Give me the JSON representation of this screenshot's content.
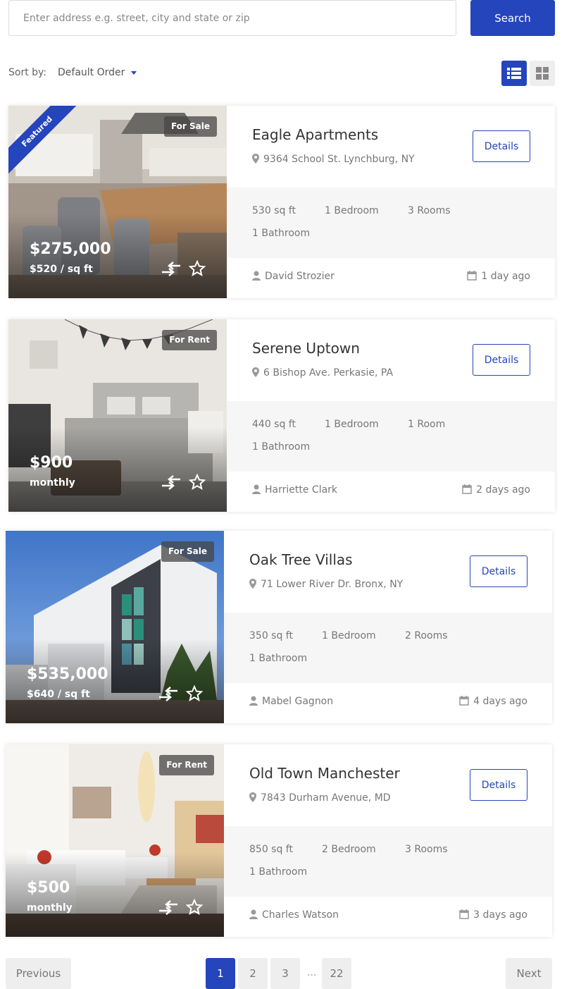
{
  "search": {
    "placeholder": "Enter address e.g. street, city and state or zip",
    "button_label": "Search"
  },
  "sort": {
    "label": "Sort by:",
    "value": "Default Order"
  },
  "view_modes": [
    "list-icon",
    "grid-icon"
  ],
  "accent_color": "#2545bd",
  "listings": [
    {
      "title": "Eagle Apartments",
      "address": "9364 School St. Lynchburg, NY",
      "status": "For Sale",
      "ribbon": "Featured",
      "price": "$275,000",
      "price_sub": "$520 / sq ft",
      "details_label": "Details",
      "features": [
        "530 sq ft",
        "1 Bedroom",
        "3 Rooms",
        "1 Bathroom"
      ],
      "agent": "David Strozier",
      "posted": "1 day ago"
    },
    {
      "title": "Serene Uptown",
      "address": "6 Bishop Ave. Perkasie, PA",
      "status": "For Rent",
      "price": "$900",
      "price_sub": "monthly",
      "details_label": "Details",
      "features": [
        "440 sq ft",
        "1 Bedroom",
        "1 Room",
        "1 Bathroom"
      ],
      "agent": "Harriette Clark",
      "posted": "2 days ago"
    },
    {
      "title": "Oak Tree Villas",
      "address": "71 Lower River Dr. Bronx, NY",
      "status": "For Sale",
      "price": "$535,000",
      "price_sub": "$640 / sq ft",
      "details_label": "Details",
      "features": [
        "350 sq ft",
        "1 Bedroom",
        "2 Rooms",
        "1 Bathroom"
      ],
      "agent": "Mabel Gagnon",
      "posted": "4 days ago"
    },
    {
      "title": "Old Town Manchester",
      "address": "7843 Durham Avenue, MD",
      "status": "For Rent",
      "price": "$500",
      "price_sub": "monthly",
      "details_label": "Details",
      "features": [
        "850 sq ft",
        "2 Bedroom",
        "3 Rooms",
        "1 Bathroom"
      ],
      "agent": "Charles Watson",
      "posted": "3 days ago"
    }
  ],
  "pagination": {
    "previous_label": "Previous",
    "next_label": "Next",
    "pages": [
      "1",
      "2",
      "3",
      "22"
    ],
    "current": "1",
    "ellipsis": "..."
  }
}
